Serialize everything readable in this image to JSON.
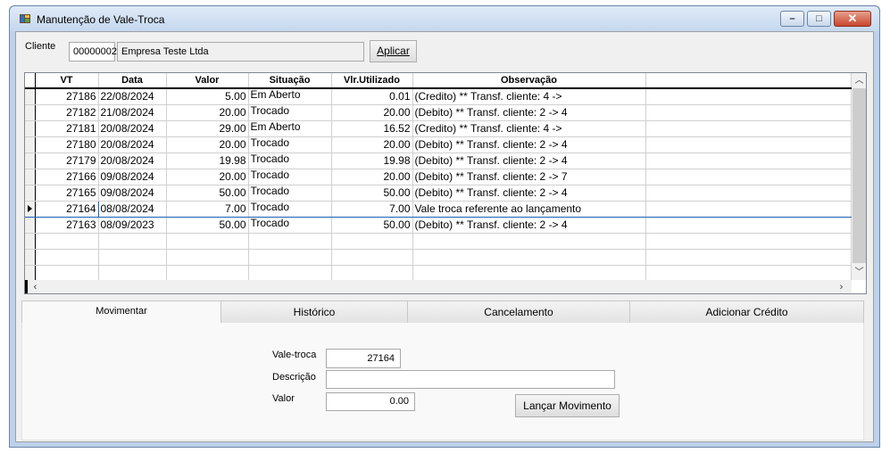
{
  "window": {
    "title": "Manutenção de Vale-Troca"
  },
  "client": {
    "label": "Cliente",
    "code": "00000002",
    "name": "Empresa Teste Ltda",
    "apply_button": "Aplicar"
  },
  "grid": {
    "columns": [
      "VT",
      "Data",
      "Valor",
      "Situação",
      "Vlr.Utilizado",
      "Observação"
    ],
    "rows": [
      {
        "vt": "27186",
        "data": "22/08/2024",
        "valor": "5.00",
        "situacao": "Em Aberto",
        "utilizado": "0.01",
        "obs": "(Credito) ** Transf. cliente: 4 ->"
      },
      {
        "vt": "27182",
        "data": "21/08/2024",
        "valor": "20.00",
        "situacao": "Trocado",
        "utilizado": "20.00",
        "obs": "(Debito) ** Transf. cliente: 2 -> 4"
      },
      {
        "vt": "27181",
        "data": "20/08/2024",
        "valor": "29.00",
        "situacao": "Em Aberto",
        "utilizado": "16.52",
        "obs": "(Credito) ** Transf. cliente: 4 ->"
      },
      {
        "vt": "27180",
        "data": "20/08/2024",
        "valor": "20.00",
        "situacao": "Trocado",
        "utilizado": "20.00",
        "obs": "(Debito) ** Transf. cliente: 2 -> 4"
      },
      {
        "vt": "27179",
        "data": "20/08/2024",
        "valor": "19.98",
        "situacao": "Trocado",
        "utilizado": "19.98",
        "obs": "(Debito) ** Transf. cliente: 2 -> 4"
      },
      {
        "vt": "27166",
        "data": "09/08/2024",
        "valor": "20.00",
        "situacao": "Trocado",
        "utilizado": "20.00",
        "obs": "(Debito) ** Transf. cliente: 2 -> 7"
      },
      {
        "vt": "27165",
        "data": "09/08/2024",
        "valor": "50.00",
        "situacao": "Trocado",
        "utilizado": "50.00",
        "obs": "(Debito) ** Transf. cliente: 2 -> 4"
      },
      {
        "vt": "27164",
        "data": "08/08/2024",
        "valor": "7.00",
        "situacao": "Trocado",
        "utilizado": "7.00",
        "obs": "Vale troca referente ao lançamento"
      },
      {
        "vt": "27163",
        "data": "08/09/2023",
        "valor": "50.00",
        "situacao": "Trocado",
        "utilizado": "50.00",
        "obs": "(Debito) ** Transf. cliente: 2 -> 4"
      }
    ]
  },
  "tabs": [
    "Movimentar",
    "Histórico",
    "Cancelamento",
    "Adicionar Crédito"
  ],
  "form": {
    "vale_label": "Vale-troca",
    "vale_value": "27164",
    "descricao_label": "Descrição",
    "descricao_value": "",
    "valor_label": "Valor",
    "valor_value": "0.00",
    "submit_button": "Lançar Movimento"
  }
}
